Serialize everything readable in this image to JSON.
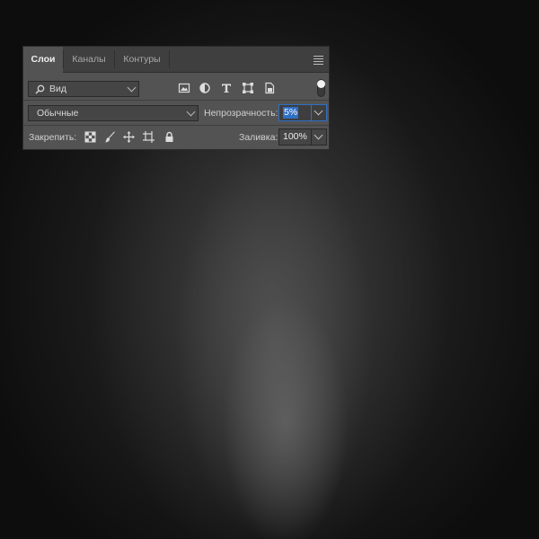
{
  "panel": {
    "tabs": [
      {
        "label": "Слои",
        "active": true
      },
      {
        "label": "Каналы",
        "active": false
      },
      {
        "label": "Контуры",
        "active": false
      }
    ],
    "menu_icon": "panel-menu-icon"
  },
  "filter": {
    "kind_label": "Вид",
    "icons": [
      "image-filter-icon",
      "adjustment-filter-icon",
      "type-filter-icon",
      "shape-filter-icon",
      "smart-object-filter-icon"
    ],
    "toggle_on": true
  },
  "blend": {
    "mode": "Обычные",
    "opacity_label": "Непрозрачность:",
    "opacity_value": "5%"
  },
  "lock": {
    "label": "Закрепить:",
    "icons": [
      "lock-transparent-pixels-icon",
      "lock-image-pixels-icon",
      "lock-position-icon",
      "lock-artboard-icon",
      "lock-all-icon"
    ],
    "fill_label": "Заливка:",
    "fill_value": "100%"
  },
  "colors": {
    "panel_bg": "#535353",
    "tab_bar_bg": "#3f3f3f",
    "focus_blue": "#2f6fc4",
    "canvas_dark": "#0d0d0d"
  }
}
